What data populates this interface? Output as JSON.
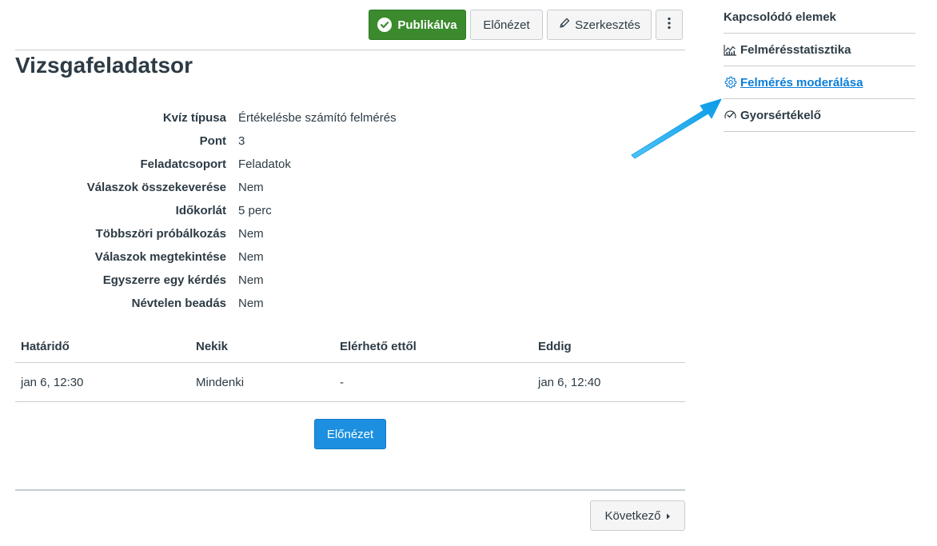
{
  "toolbar": {
    "published_label": "Publikálva",
    "preview_label": "Előnézet",
    "edit_label": "Szerkesztés",
    "more_label": "⋮"
  },
  "page": {
    "title": "Vizsgafeladatsor"
  },
  "details": [
    {
      "label": "Kvíz típusa",
      "value": "Értékelésbe számító felmérés"
    },
    {
      "label": "Pont",
      "value": "3"
    },
    {
      "label": "Feladatcsoport",
      "value": "Feladatok"
    },
    {
      "label": "Válaszok összekeverése",
      "value": "Nem"
    },
    {
      "label": "Időkorlát",
      "value": "5 perc"
    },
    {
      "label": "Többszöri próbálkozás",
      "value": "Nem"
    },
    {
      "label": "Válaszok megtekintése",
      "value": "Nem"
    },
    {
      "label": "Egyszerre egy kérdés",
      "value": "Nem"
    },
    {
      "label": "Névtelen beadás",
      "value": "Nem"
    }
  ],
  "due_table": {
    "headers": [
      "Határidő",
      "Nekik",
      "Elérhető ettől",
      "Eddig"
    ],
    "rows": [
      [
        "jan 6, 12:30",
        "Mindenki",
        "-",
        "jan 6, 12:40"
      ]
    ]
  },
  "main": {
    "preview_label": "Előnézet",
    "next_label": "Következő"
  },
  "sidebar": {
    "title": "Kapcsolódó elemek",
    "items": [
      {
        "label": "Felmérésstatisztika",
        "icon": "stats-icon"
      },
      {
        "label": "Felmérés moderálása",
        "icon": "gear-icon",
        "active": true
      },
      {
        "label": "Gyorsértékelő",
        "icon": "speedgrader-icon"
      }
    ]
  },
  "colors": {
    "published": "#3b8a2d",
    "primary": "#1c8fe0",
    "link": "#0a7ed8",
    "annotation_arrow": "#1aa3e8",
    "text": "#2d3b45",
    "border": "#c7cdd1"
  }
}
